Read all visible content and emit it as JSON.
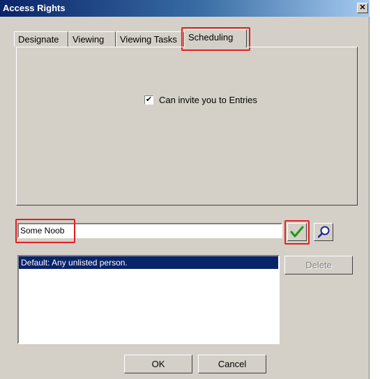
{
  "window": {
    "title": "Access Rights",
    "close_glyph": "✕"
  },
  "tabs": [
    {
      "label": "Designate"
    },
    {
      "label": "Viewing"
    },
    {
      "label": "Viewing Tasks"
    },
    {
      "label": "Scheduling",
      "active": true
    }
  ],
  "scheduling": {
    "checkbox_label": "Can invite you to Entries",
    "checked": true,
    "check_glyph": "✔"
  },
  "name_field": {
    "value": "Some Noob"
  },
  "list": {
    "items": [
      {
        "label": "Default: Any unlisted person.",
        "selected": true
      }
    ]
  },
  "buttons": {
    "delete": "Delete",
    "ok": "OK",
    "cancel": "Cancel"
  },
  "icons": {
    "confirm": "checkmark-icon",
    "search": "magnifier-icon"
  },
  "colors": {
    "highlight": "#e02020",
    "selection": "#0a246a",
    "check_green": "#1a9a1a"
  }
}
